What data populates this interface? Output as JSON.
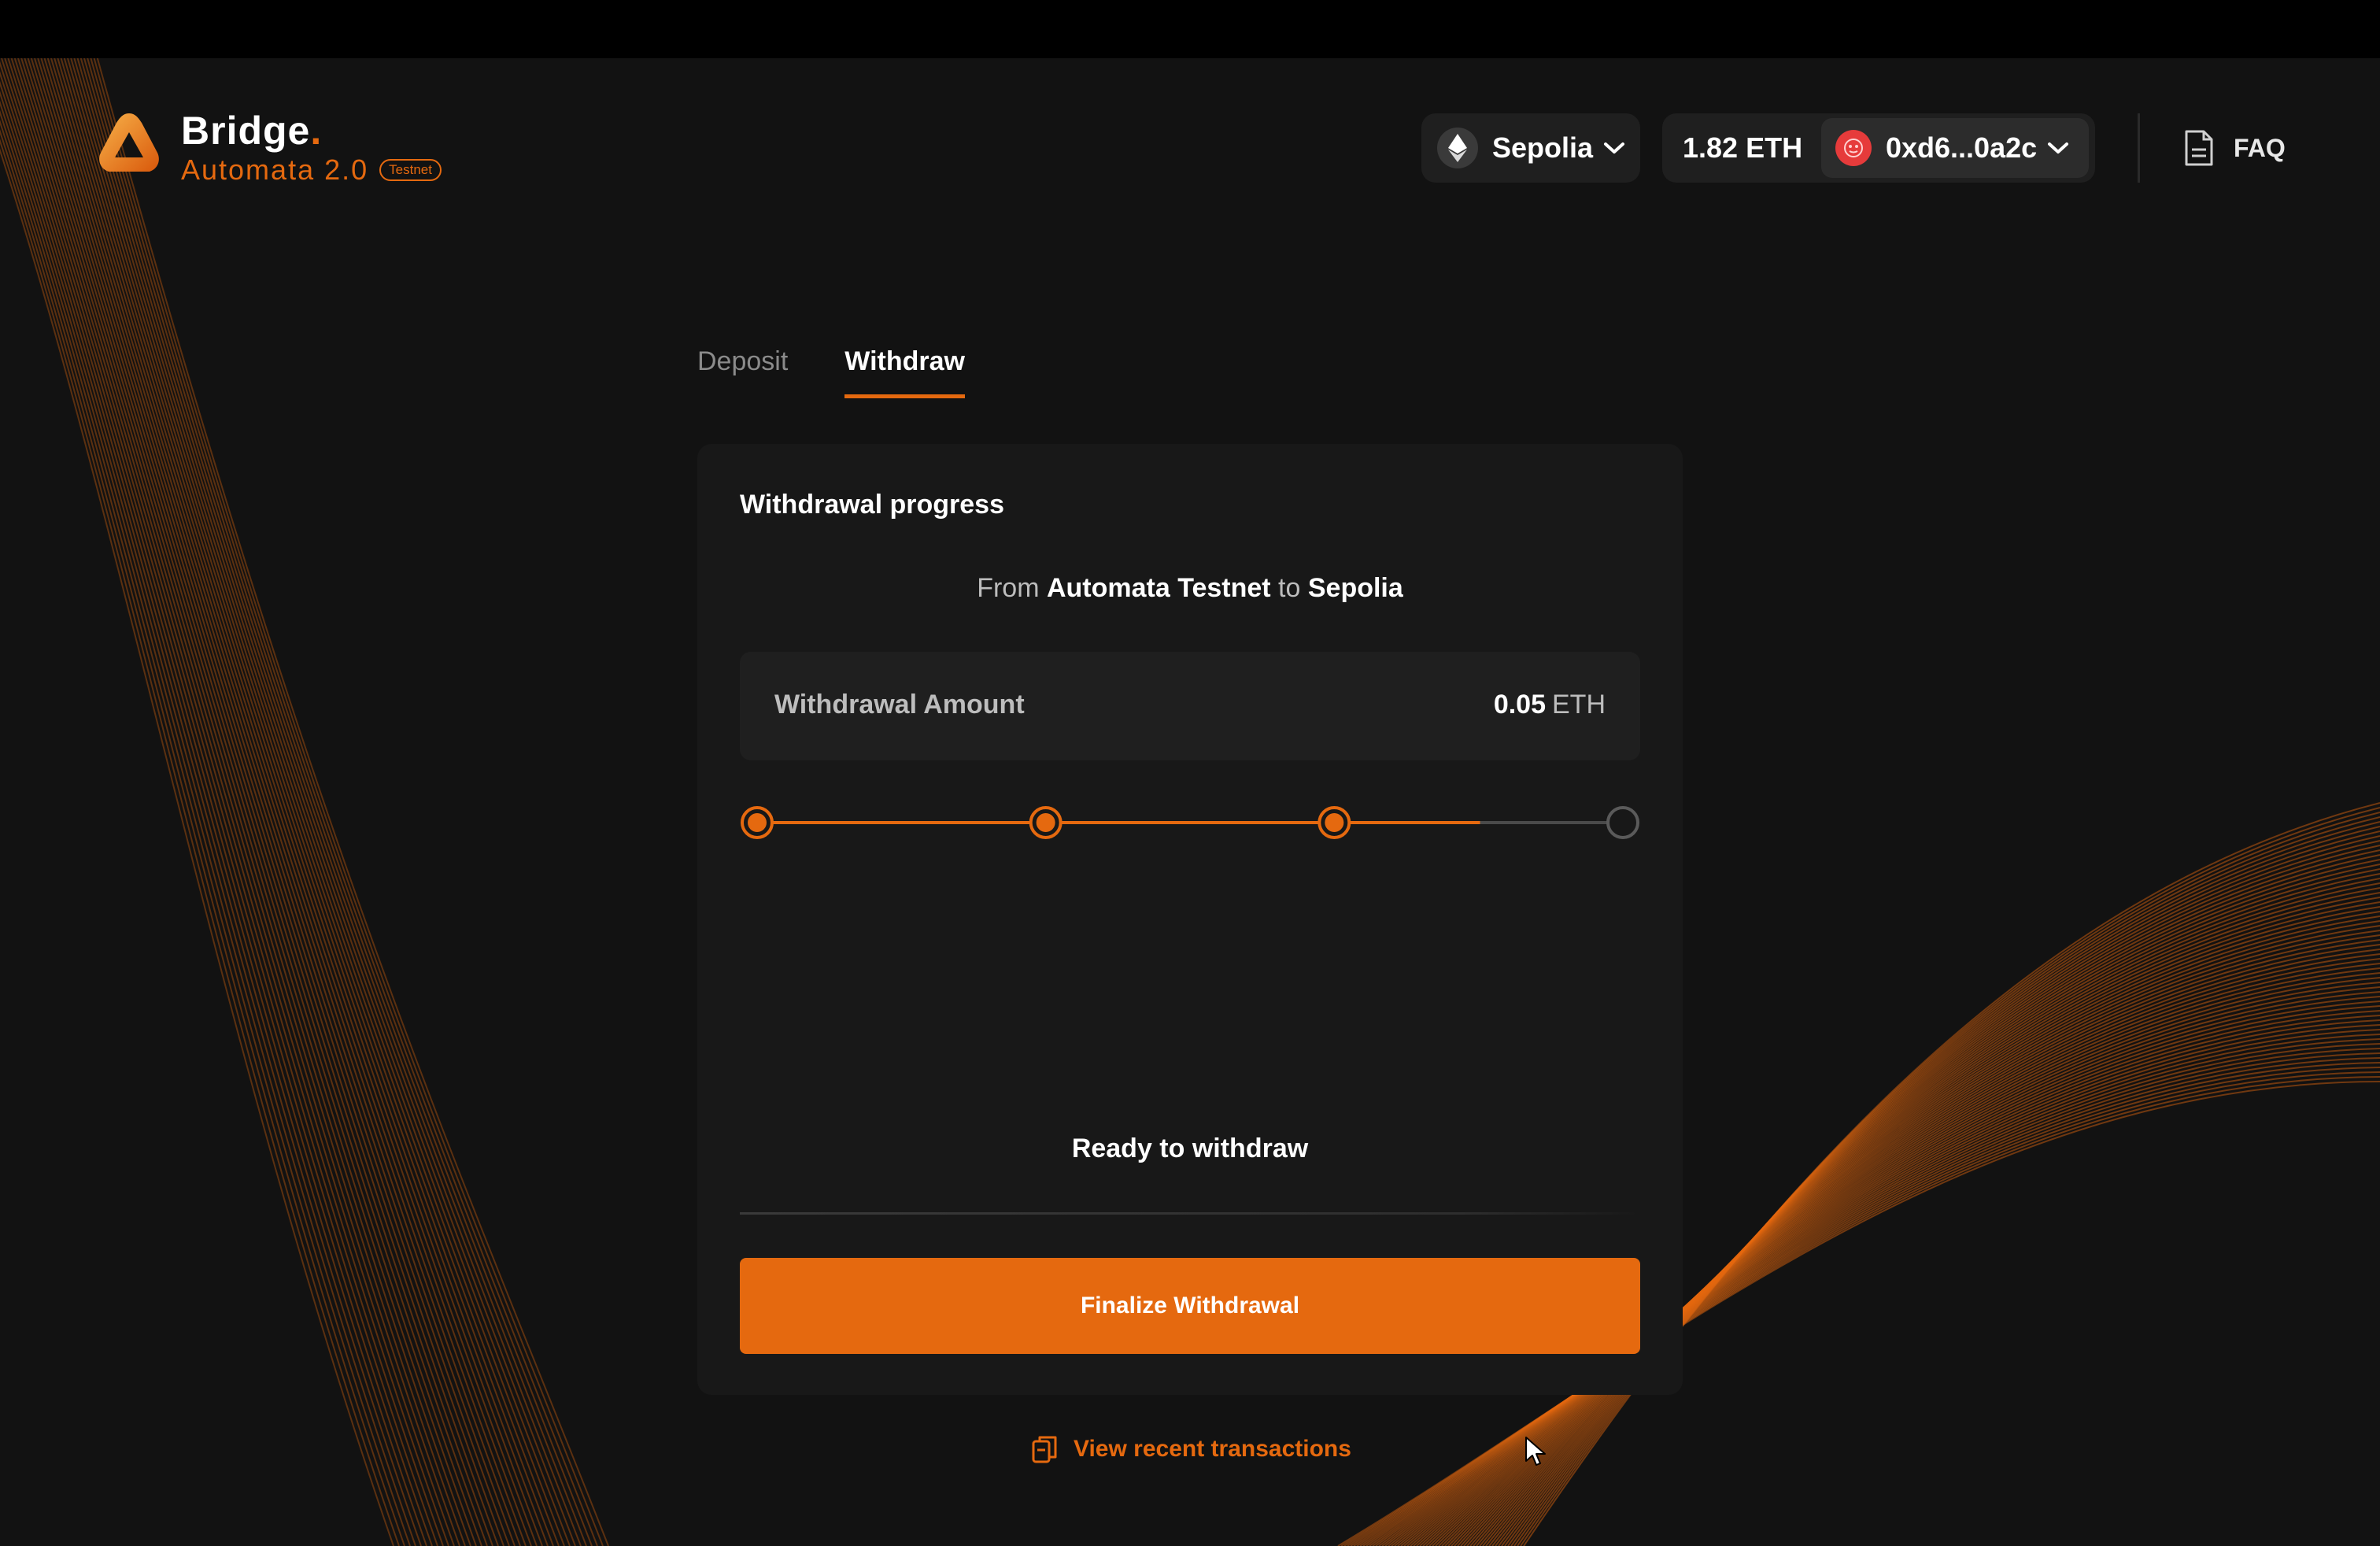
{
  "header": {
    "logo_title": "Bridge",
    "logo_dot": ".",
    "logo_subtitle": "Automata 2.0",
    "badge": "Testnet",
    "network": "Sepolia",
    "balance": "1.82 ETH",
    "address": "0xd6...0a2c",
    "faq_label": "FAQ"
  },
  "tabs": [
    {
      "label": "Deposit",
      "active": false
    },
    {
      "label": "Withdraw",
      "active": true
    }
  ],
  "card": {
    "title": "Withdrawal progress",
    "route": {
      "from_word": "From",
      "from_network": "Automata Testnet",
      "to_word": "to",
      "to_network": "Sepolia"
    },
    "amount": {
      "label": "Withdrawal Amount",
      "value": "0.05",
      "unit": "ETH"
    },
    "progress": {
      "steps_total": 4,
      "steps_completed": 3,
      "fill_fraction": 0.835
    },
    "status": "Ready to withdraw",
    "action_label": "Finalize Withdrawal"
  },
  "footer": {
    "recent_label": "View recent transactions"
  },
  "colors": {
    "accent": "#e5690f",
    "background": "#121212",
    "card": "#181818",
    "panel": "#1f1f1f"
  },
  "icons": [
    "triangle-logo-icon",
    "ethereum-icon",
    "chevron-down-icon",
    "wallet-avatar-icon",
    "document-icon",
    "copy-icon",
    "mouse-cursor-icon"
  ]
}
